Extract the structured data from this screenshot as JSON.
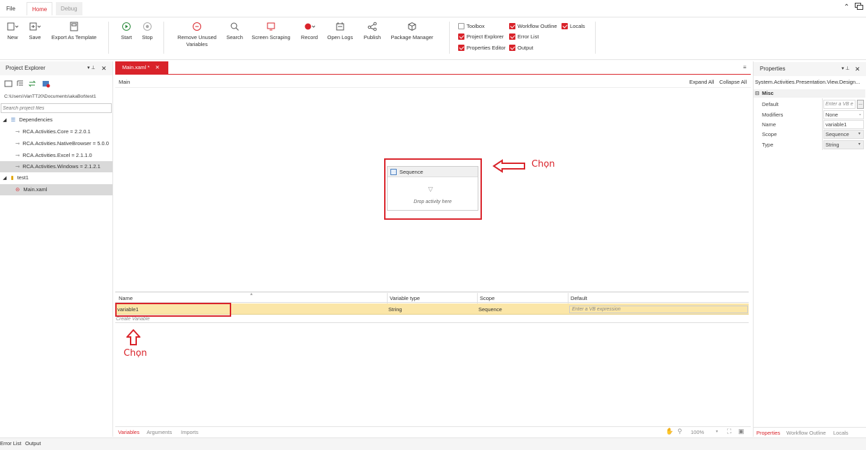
{
  "menu": {
    "file": "File",
    "home": "Home",
    "debug": "Debug"
  },
  "ribbon": {
    "new": "New",
    "save": "Save",
    "export_template": "Export As Template",
    "start": "Start",
    "stop": "Stop",
    "remove_unused_1": "Remove Unused",
    "remove_unused_2": "Variables",
    "search": "Search",
    "screen_scraping": "Screen Scraping",
    "record": "Record",
    "open_logs": "Open Logs",
    "publish": "Publish",
    "package_manager": "Package Manager"
  },
  "view_toggles": [
    {
      "label": "Toolbox",
      "checked": false
    },
    {
      "label": "Workflow Outline",
      "checked": true
    },
    {
      "label": "Locals",
      "checked": true
    },
    {
      "label": "Project Explorer",
      "checked": true
    },
    {
      "label": "Error List",
      "checked": true
    },
    {
      "label": "Properties Editor",
      "checked": true
    },
    {
      "label": "Output",
      "checked": true
    }
  ],
  "project_explorer": {
    "title": "Project Explorer",
    "path": "C:\\Users\\VanTT20\\Documents\\akaBot\\test1",
    "search_placeholder": "Search project files",
    "dependencies_label": "Dependencies",
    "dependencies": [
      "RCA.Activities.Core = 2.2.0.1",
      "RCA.Activities.NativeBrowser = 5.0.0",
      "RCA.Activities.Excel = 2.1.1.0",
      "RCA.Activities.Windows = 2.1.2.1"
    ],
    "project_label": "test1",
    "file_label": "Main.xaml"
  },
  "designer": {
    "tab_label": "Main.xaml *",
    "breadcrumb": "Main",
    "expand_all": "Expand All",
    "collapse_all": "Collapse All",
    "sequence_title": "Sequence",
    "drop_hint": "Drop activity here"
  },
  "variables": {
    "columns": [
      "Name",
      "Variable type",
      "Scope",
      "Default"
    ],
    "rows": [
      {
        "name": "variable1",
        "type": "String",
        "scope": "Sequence",
        "default": "Enter a VB expression"
      }
    ],
    "create_label": "Create Variable"
  },
  "bottom_tabs": {
    "variables": "Variables",
    "arguments": "Arguments",
    "imports": "Imports",
    "zoom": "100%"
  },
  "properties": {
    "title": "Properties",
    "type_name": "System.Activities.Presentation.View.Design...",
    "group": "Misc",
    "rows": [
      {
        "label": "Default",
        "value": "Enter a VB e"
      },
      {
        "label": "Modifiers",
        "value": "None"
      },
      {
        "label": "Name",
        "value": "variable1"
      },
      {
        "label": "Scope",
        "value": "Sequence"
      },
      {
        "label": "Type",
        "value": "String"
      }
    ],
    "tabs": [
      "Properties",
      "Workflow Outline",
      "Locals"
    ]
  },
  "status_tabs": {
    "error_list": "Error List",
    "output": "Output"
  },
  "annotations": {
    "choose_1": "Chọn",
    "choose_2": "Chọn"
  },
  "colors": {
    "accent": "#d9232a",
    "selected_row": "#fbe6a8"
  }
}
